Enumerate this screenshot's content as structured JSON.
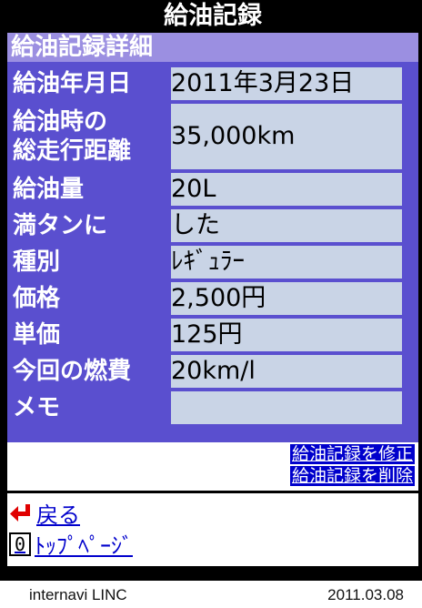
{
  "header": {
    "title": "給油記録"
  },
  "section": {
    "title": "給油記録詳細"
  },
  "rows": [
    {
      "label": "給油年月日",
      "value": "2011年3月23日"
    },
    {
      "label": "給油時の\n総走行距離",
      "value": "35,000km"
    },
    {
      "label": "給油量",
      "value": "20L"
    },
    {
      "label": "満タンに",
      "value": "した"
    },
    {
      "label": "種別",
      "value": "ﾚｷﾞｭﾗｰ"
    },
    {
      "label": "価格",
      "value": "2,500円"
    },
    {
      "label": "単価",
      "value": "125円"
    },
    {
      "label": "今回の燃費",
      "value": "20km/l"
    },
    {
      "label": "メモ",
      "value": ""
    }
  ],
  "actions": {
    "edit_label": "給油記録を修正",
    "delete_label": "給油記録を削除"
  },
  "nav": {
    "back_label": "戻る",
    "top_key": "0",
    "top_label": "ﾄｯﾌﾟﾍﾟｰｼﾞ"
  },
  "footer": {
    "left": "internavi LINC",
    "right": "2011.03.08"
  },
  "colors": {
    "label_bg": "#5a4fcf",
    "value_bg": "#c9d4e6",
    "section_bg": "#9b8fe1",
    "link_bg": "#0000cc",
    "back_arrow": "#e00000"
  }
}
